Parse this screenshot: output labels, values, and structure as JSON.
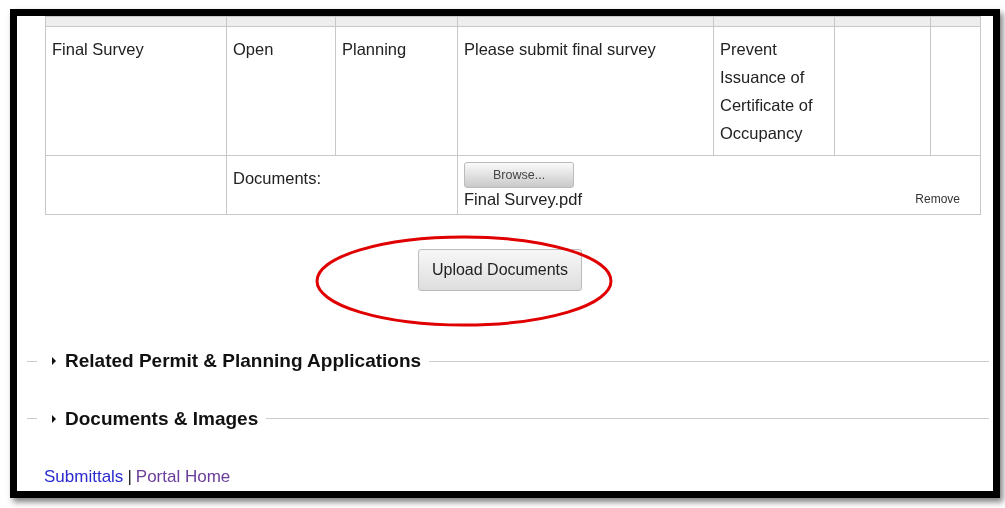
{
  "table": {
    "rows": [
      {
        "cells": [
          "Final Survey",
          "Open",
          "Planning",
          "Please submit final survey",
          "Prevent Issuance of Certificate of Occupancy"
        ]
      }
    ],
    "documents_row": {
      "label": "Documents:",
      "browse_button": "Browse...",
      "file": "Final Survey.pdf",
      "remove_link": "Remove"
    }
  },
  "upload_button": {
    "label": "Upload Documents",
    "highlighted": true
  },
  "sections": [
    {
      "title": "Related Permit & Planning Applications",
      "expanded": false
    },
    {
      "title": "Documents & Images",
      "expanded": false
    }
  ],
  "footer_links": [
    {
      "label": "Submittals",
      "visited": false
    },
    {
      "label": "Portal Home",
      "visited": true
    }
  ],
  "separator": "|"
}
